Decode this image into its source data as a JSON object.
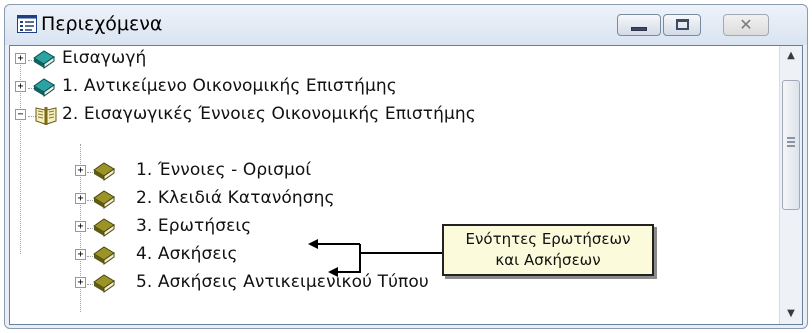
{
  "window": {
    "title": "Περιεχόμενα",
    "close_glyph": "✕",
    "icons": [
      "document-tree-icon",
      "minimize-icon",
      "maximize-icon",
      "close-icon"
    ]
  },
  "tree": {
    "items": [
      {
        "label": "Εισαγωγή",
        "icon": "book-closed-icon",
        "expander": "+"
      },
      {
        "label": "1.  Αντικείμενο Οικονομικής Επιστήμης",
        "icon": "book-closed-icon",
        "expander": "+"
      },
      {
        "label": "2.  Εισαγωγικές Έννοιες Οικονομικής Επιστήμης",
        "icon": "book-open-icon",
        "expander": "−"
      },
      {
        "label": "1.  Έννοιες - Ορισμοί",
        "icon": "book-closed-icon",
        "expander": "+"
      },
      {
        "label": "2.  Κλειδιά Κατανόησης",
        "icon": "book-closed-icon",
        "expander": "+"
      },
      {
        "label": "3.  Ερωτήσεις",
        "icon": "book-closed-icon",
        "expander": "+"
      },
      {
        "label": "4.  Ασκήσεις",
        "icon": "book-closed-icon",
        "expander": "+"
      },
      {
        "label": "5.  Ασκήσεις Αντικειμενικού Τύπου",
        "icon": "book-closed-icon",
        "expander": "+"
      }
    ]
  },
  "scrollbar": {
    "up": "▲",
    "down": "▼"
  },
  "callout": {
    "line1": "Ενότητες Ερωτήσεων",
    "line2": "και Ασκήσεων"
  },
  "colors": {
    "book_teal": "#1f8a8a",
    "book_olive": "#7b7a1e",
    "callout_bg": "#fbfbdc"
  }
}
